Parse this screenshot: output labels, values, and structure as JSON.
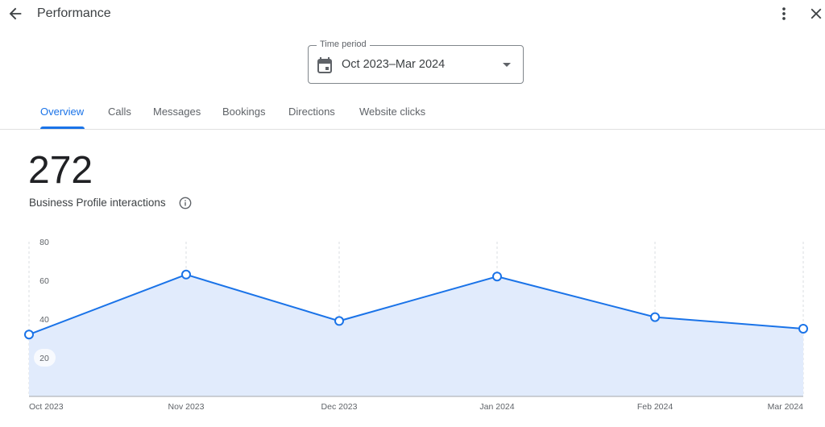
{
  "header": {
    "title": "Performance",
    "back_icon": "arrow-back-icon",
    "more_icon": "more-vert-icon",
    "close_icon": "close-icon"
  },
  "time_period": {
    "label": "Time period",
    "value": "Oct 2023–Mar 2024",
    "icon": "calendar-icon",
    "dropdown_icon": "arrow-drop-down-icon"
  },
  "tabs": [
    {
      "label": "Overview",
      "active": true
    },
    {
      "label": "Calls",
      "active": false
    },
    {
      "label": "Messages",
      "active": false
    },
    {
      "label": "Bookings",
      "active": false
    },
    {
      "label": "Directions",
      "active": false
    },
    {
      "label": "Website clicks",
      "active": false
    }
  ],
  "summary": {
    "total": "272",
    "label": "Business Profile interactions",
    "info_icon": "info-icon"
  },
  "colors": {
    "accent": "#1a73e8",
    "line": "#1a73e8",
    "area_fill": "#e1ebfc"
  },
  "chart_data": {
    "type": "area",
    "title": "Business Profile interactions",
    "categories": [
      "Oct 2023",
      "Nov 2023",
      "Dec 2023",
      "Jan 2024",
      "Feb 2024",
      "Mar 2024"
    ],
    "series": [
      {
        "name": "Business Profile interactions",
        "values": [
          32,
          63,
          39,
          62,
          41,
          35
        ]
      }
    ],
    "yticks": [
      20,
      40,
      60,
      80
    ],
    "ylim": [
      0,
      80
    ],
    "xlabel": "",
    "ylabel": "",
    "grid": "vertical dashed",
    "legend": "none"
  }
}
